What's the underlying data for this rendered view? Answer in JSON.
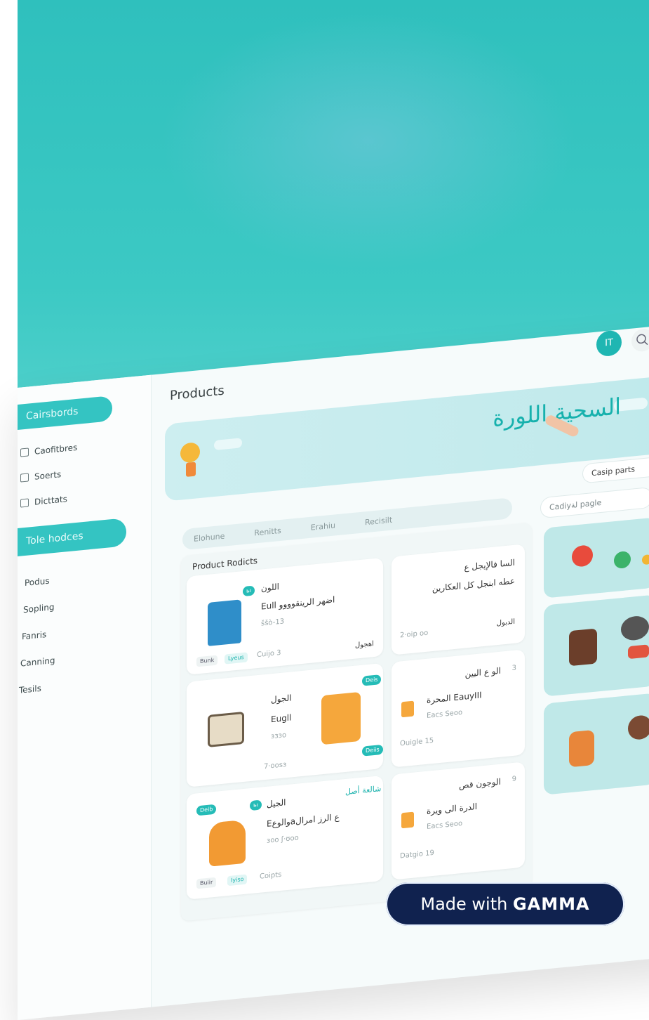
{
  "header": {
    "title": "Products",
    "avatar_initials": "IT"
  },
  "sidebar": {
    "top_pill": "Cairsbords",
    "items": [
      {
        "label": "Caofitbres",
        "icon": "table-icon"
      },
      {
        "label": "Soerts",
        "icon": "list-icon"
      },
      {
        "label": "Dicttats",
        "icon": "doc-icon"
      }
    ],
    "second_pill": "Tole hodces",
    "links": [
      "Podus",
      "Sopling",
      "Fanris",
      "Canning",
      "Tesils"
    ]
  },
  "banner": {
    "title": "السحية اللورة"
  },
  "dropdown": {
    "value": "Casip parts"
  },
  "side_search": {
    "placeholder": "Cadiyلة pagle"
  },
  "tabs": [
    "Elohune",
    "Renitts",
    "Erahiu",
    "Recisilt"
  ],
  "product_panel": {
    "title": "Product Rodicts",
    "rows": [
      {
        "badge": "ьı",
        "name": "اللون",
        "subtitle": "Eull اضهر الرينقوووو",
        "meta": "ššò-13",
        "chip1": "Bunk",
        "chip2": "Lyeus",
        "code": "Cuijo 3",
        "tag": "اهجول",
        "right_title": "السا فالإيجل ع",
        "right_subtitle": "عطه ابنجل كل العكارين",
        "right_meta": "2·oip oo",
        "right_tag": "الدبول"
      },
      {
        "badge": "Deis",
        "name": "الجول",
        "subtitle": "Eugll",
        "meta": "ɜɜɜo",
        "code": "7·oosɜ",
        "badge2": "Deiis",
        "right_title": "الو ع اليين",
        "right_subtitle": "المحرة EauyIII",
        "right_meta": "Eacs Seoo",
        "right_code": "Ouigle 15",
        "right_num": "3"
      },
      {
        "badge": "Deib",
        "badge2": "ьı",
        "name": "الجيل",
        "subtitle": "Eوالوعaع الرز امرال",
        "meta": "ɜoo ʃ·ʊoo",
        "chip1": "Buiir",
        "chip2": "Iyiso",
        "code": "Coipts",
        "link": "شالعة أصل",
        "right_title": "الوجون قص",
        "right_subtitle": "الدرة الى ويرة",
        "right_meta": "Eacs Seoo",
        "right_code": "Datgio 19",
        "right_num": "9"
      }
    ]
  },
  "gamma": {
    "prefix": "Made with",
    "brand": "GAMMA"
  },
  "colors": {
    "accent": "#34c4c2",
    "brand_dark": "#10224f"
  }
}
